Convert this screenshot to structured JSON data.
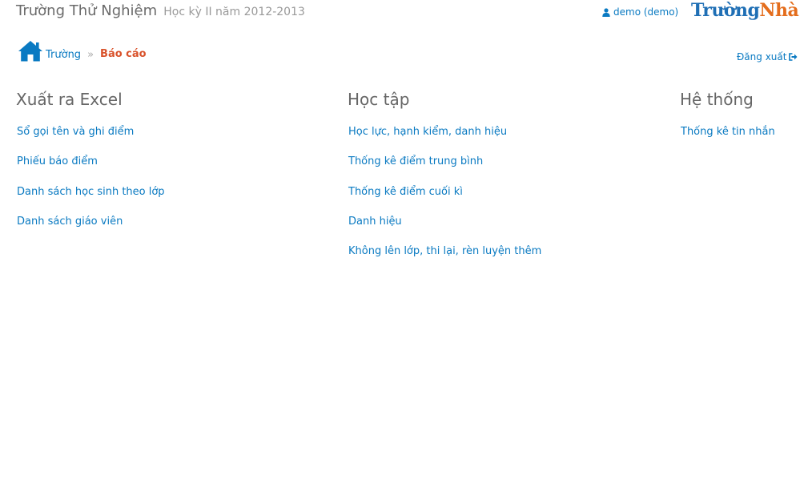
{
  "header": {
    "school_name": "Trường Thử Nghiệm",
    "term": "Học kỳ II năm 2012-2013",
    "user": "demo (demo)",
    "brand_part1": "Trường",
    "brand_part2": "Nhà",
    "icons": {
      "user": "user-icon",
      "home": "home-icon",
      "logout": "sign-out-icon"
    }
  },
  "breadcrumb": {
    "home": "Trường",
    "separator": "»",
    "current": "Báo cáo"
  },
  "logout_label": "Đăng xuất",
  "colors": {
    "link": "#0a7ac2",
    "current": "#d9532c",
    "brand_blue": "#1f6fb5",
    "brand_orange": "#e46d1c"
  },
  "columns": [
    {
      "heading": "Xuất ra Excel",
      "links": [
        "Sổ gọi tên và ghi điểm",
        "Phiếu báo điểm",
        "Danh sách học sinh theo lớp",
        "Danh sách giáo viên"
      ]
    },
    {
      "heading": "Học tập",
      "links": [
        "Học lực, hạnh kiểm, danh hiệu",
        "Thống kê điểm trung bình",
        "Thống kê điểm cuối kì",
        "Danh hiệu",
        "Không lên lớp, thi lại, rèn luyện thêm"
      ]
    },
    {
      "heading": "Hệ thống",
      "links": [
        "Thống kê tin nhắn"
      ]
    }
  ]
}
